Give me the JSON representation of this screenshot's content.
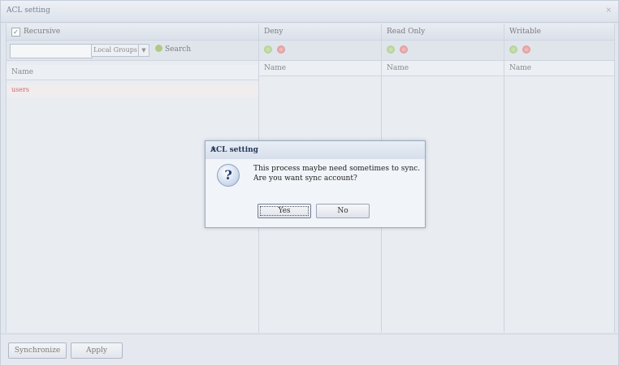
{
  "window": {
    "title": "ACL setting",
    "close_glyph": "×"
  },
  "left_panel": {
    "recursive_label": "Recursive",
    "recursive_checked": true,
    "search_input": {
      "value": "",
      "placeholder": ""
    },
    "group_select": {
      "value": "Local Groups",
      "chevron": "▼"
    },
    "search_label": "Search",
    "column_header": "Name",
    "rows": [
      {
        "name": "users"
      }
    ]
  },
  "columns": {
    "deny": {
      "header": "Deny",
      "name_header": "Name"
    },
    "read_only": {
      "header": "Read Only",
      "name_header": "Name"
    },
    "writable": {
      "header": "Writable",
      "name_header": "Name"
    }
  },
  "footer": {
    "sync_label": "Synchronize",
    "apply_label": "Apply"
  },
  "dialog": {
    "title": "ACL setting",
    "close_glyph": "×",
    "icon_glyph": "?",
    "message_line1": "This process maybe need sometimes to sync.",
    "message_line2": "Are you want sync account?",
    "yes_label": "Yes",
    "no_label": "No"
  },
  "colors": {
    "accent": "#24385a",
    "user_row_text": "#c03a3a",
    "add_icon": "#8fb95e",
    "remove_icon": "#d56363"
  }
}
